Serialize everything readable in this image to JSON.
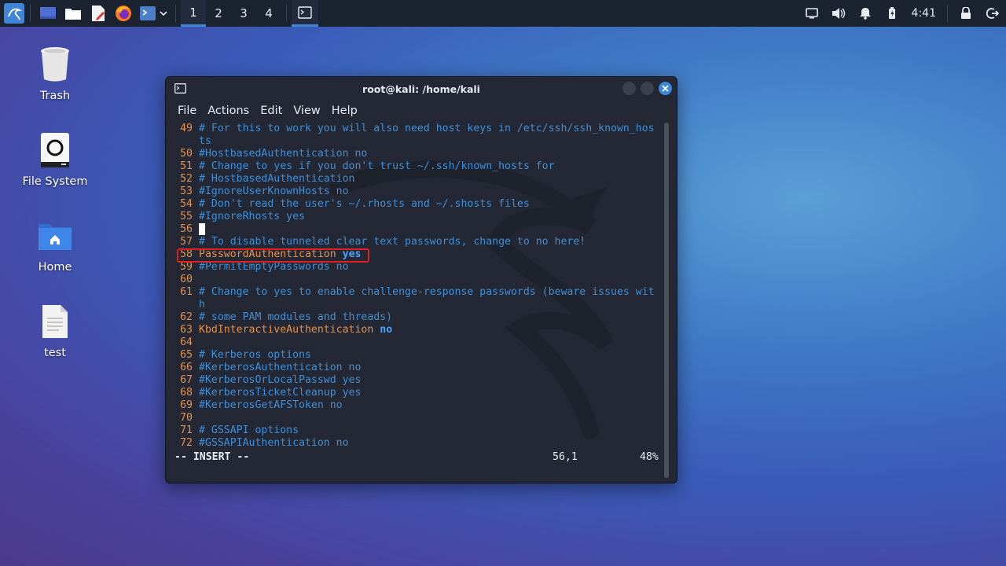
{
  "taskbar": {
    "workspaces": [
      "1",
      "2",
      "3",
      "4"
    ],
    "active_workspace": "1",
    "clock": "4:41",
    "launchers": [
      "kali-menu-icon",
      "desktop-icon",
      "file-manager-icon",
      "text-editor-icon",
      "firefox-icon",
      "terminal-icon"
    ],
    "tray": [
      "display-icon",
      "volume-icon",
      "notifications-icon",
      "battery-icon",
      "lock-icon",
      "logout-icon"
    ]
  },
  "desktop": {
    "icons": [
      {
        "label": "Trash",
        "icon": "trash-icon"
      },
      {
        "label": "File System",
        "icon": "drive-icon"
      },
      {
        "label": "Home",
        "icon": "home-folder-icon"
      },
      {
        "label": "test",
        "icon": "text-file-icon"
      }
    ]
  },
  "window": {
    "title": "root@kali: /home/kali",
    "menu": [
      "File",
      "Actions",
      "Edit",
      "View",
      "Help"
    ]
  },
  "editor": {
    "lines": [
      {
        "n": "49",
        "text": "# For this to work you will also need host keys in /etc/ssh/ssh_known_hos",
        "cont": "ts"
      },
      {
        "n": "50",
        "text": "#HostbasedAuthentication no"
      },
      {
        "n": "51",
        "text": "# Change to yes if you don't trust ~/.ssh/known_hosts for"
      },
      {
        "n": "52",
        "text": "# HostbasedAuthentication"
      },
      {
        "n": "53",
        "text": "#IgnoreUserKnownHosts no"
      },
      {
        "n": "54",
        "text": "# Don't read the user's ~/.rhosts and ~/.shosts files"
      },
      {
        "n": "55",
        "text": "#IgnoreRhosts yes"
      },
      {
        "n": "56",
        "text": ""
      },
      {
        "n": "57",
        "text": "# To disable tunneled clear text passwords, change to no here!"
      },
      {
        "n": "58",
        "key": "PasswordAuthentication",
        "value": "yes"
      },
      {
        "n": "59",
        "text": "#PermitEmptyPasswords no"
      },
      {
        "n": "60",
        "text": ""
      },
      {
        "n": "61",
        "text": "# Change to yes to enable challenge-response passwords (beware issues wit",
        "cont": "h"
      },
      {
        "n": "62",
        "text": "# some PAM modules and threads)"
      },
      {
        "n": "63",
        "key": "KbdInteractiveAuthentication",
        "value": "no"
      },
      {
        "n": "64",
        "text": ""
      },
      {
        "n": "65",
        "text": "# Kerberos options"
      },
      {
        "n": "66",
        "text": "#KerberosAuthentication no"
      },
      {
        "n": "67",
        "text": "#KerberosOrLocalPasswd yes"
      },
      {
        "n": "68",
        "text": "#KerberosTicketCleanup yes"
      },
      {
        "n": "69",
        "text": "#KerberosGetAFSToken no"
      },
      {
        "n": "70",
        "text": ""
      },
      {
        "n": "71",
        "text": "# GSSAPI options"
      },
      {
        "n": "72",
        "text": "#GSSAPIAuthentication no"
      }
    ],
    "mode": "-- INSERT --",
    "position": "56,1",
    "percent": "48%"
  }
}
